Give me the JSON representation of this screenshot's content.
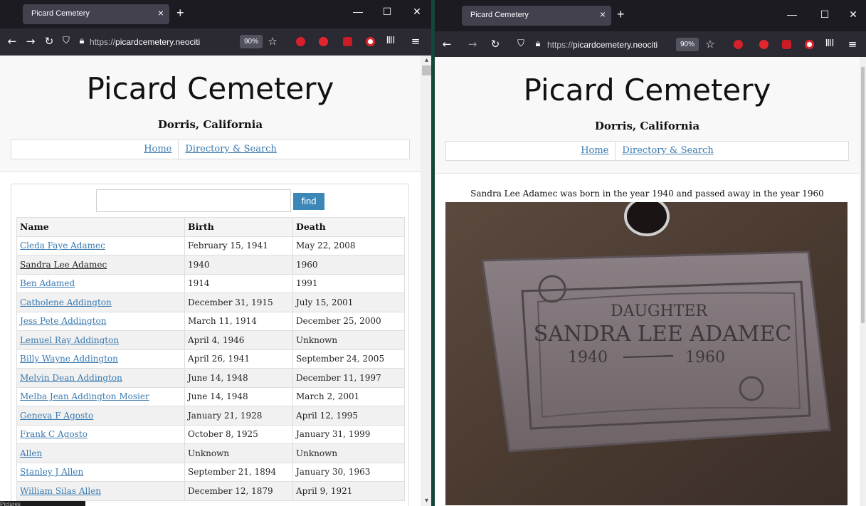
{
  "left_window": {
    "tab": {
      "title": "Picard Cemetery",
      "close": "×"
    },
    "newtab": "+",
    "controls": {
      "minimize": "—",
      "maximize": "☐",
      "close": "✕"
    },
    "nav": {
      "back": "←",
      "forward": "→",
      "reload": "↻"
    },
    "url": {
      "scheme": "https://",
      "host": "picardcemetery.neociti"
    },
    "zoom": "90%",
    "menu": "≡"
  },
  "right_window": {
    "tab": {
      "title": "Picard Cemetery",
      "close": "×"
    },
    "newtab": "+",
    "controls": {
      "minimize": "—",
      "maximize": "☐",
      "close": "✕"
    },
    "nav": {
      "back": "←",
      "forward": "→",
      "reload": "↻"
    },
    "url": {
      "scheme": "https://",
      "host": "picardcemetery.neociti"
    },
    "zoom": "90%",
    "menu": "≡"
  },
  "site": {
    "title": "Picard Cemetery",
    "subtitle": "Dorris, California",
    "nav": [
      "Home",
      "Directory & Search"
    ]
  },
  "directory": {
    "search_placeholder": "",
    "find_label": "find",
    "columns": [
      "Name",
      "Birth",
      "Death"
    ],
    "rows": [
      {
        "name": "Cleda Faye Adamec",
        "birth": "February 15, 1941",
        "death": "May 22, 2008"
      },
      {
        "name": "Sandra Lee Adamec",
        "birth": "1940",
        "death": "1960"
      },
      {
        "name": "Ben Adamed",
        "birth": "1914",
        "death": "1991"
      },
      {
        "name": "Catholene Addington",
        "birth": "December 31, 1915",
        "death": "July 15, 2001"
      },
      {
        "name": "Jess Pete Addington",
        "birth": "March 11, 1914",
        "death": "December 25, 2000"
      },
      {
        "name": "Lemuel Ray Addington",
        "birth": "April 4, 1946",
        "death": "Unknown"
      },
      {
        "name": "Billy Wayne Addington",
        "birth": "April 26, 1941",
        "death": "September 24, 2005"
      },
      {
        "name": "Melvin Dean Addington",
        "birth": "June 14, 1948",
        "death": "December 11, 1997"
      },
      {
        "name": "Melba Jean Addington Mosier",
        "birth": "June 14, 1948",
        "death": "March 2, 2001"
      },
      {
        "name": "Geneva F Agosto",
        "birth": "January 21, 1928",
        "death": "April 12, 1995"
      },
      {
        "name": "Frank C Agosto",
        "birth": "October 8, 1925",
        "death": "January 31, 1999"
      },
      {
        "name": "Allen",
        "birth": "Unknown",
        "death": "Unknown"
      },
      {
        "name": "Stanley J Allen",
        "birth": "September 21, 1894",
        "death": "January 30, 1963"
      },
      {
        "name": "William Silas Allen",
        "birth": "December 12, 1879",
        "death": "April 9, 1921"
      }
    ]
  },
  "detail": {
    "caption": "Sandra Lee Adamec was born in the year 1940 and passed away in the year 1960",
    "headstone": {
      "line1": "DAUGHTER",
      "line2": "SANDRA LEE ADAMEC",
      "birth": "1940",
      "death": "1960"
    }
  },
  "taskbar": {
    "label": "Pictures"
  },
  "colors": {
    "link": "#3a7ab0",
    "find_button": "#3a87b8",
    "divider": "#14463a"
  }
}
